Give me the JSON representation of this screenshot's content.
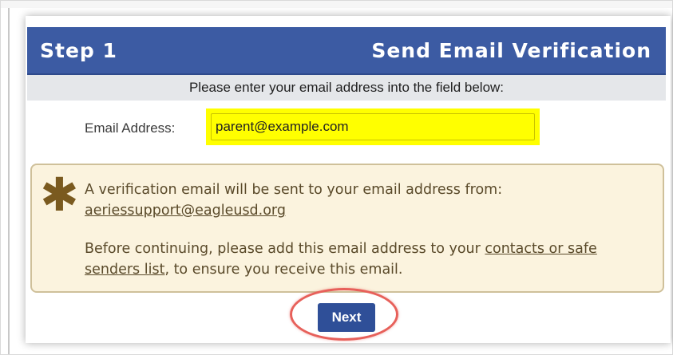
{
  "header": {
    "step": "Step 1",
    "title": "Send Email Verification"
  },
  "instruction": "Please enter your email address into the field below:",
  "email": {
    "label": "Email Address:",
    "value": "parent@example.com"
  },
  "notice": {
    "icon": "asterisk-icon",
    "line1": "A verification email will be sent to your email address from:",
    "sender": "aeriessupport@eagleusd.org",
    "line2_pre": "Before continuing, please add this email address to your ",
    "line2_link_a": "contacts or safe",
    "line2_link_b": "senders list",
    "line2_post": ", to ensure you receive this email."
  },
  "next_button": {
    "label": "Next"
  },
  "colors": {
    "header_bg": "#3c5ba3",
    "highlight": "#ffff00",
    "notice_bg": "#fbf3de",
    "annotation": "#e7605a",
    "button_bg": "#2f4f98"
  }
}
